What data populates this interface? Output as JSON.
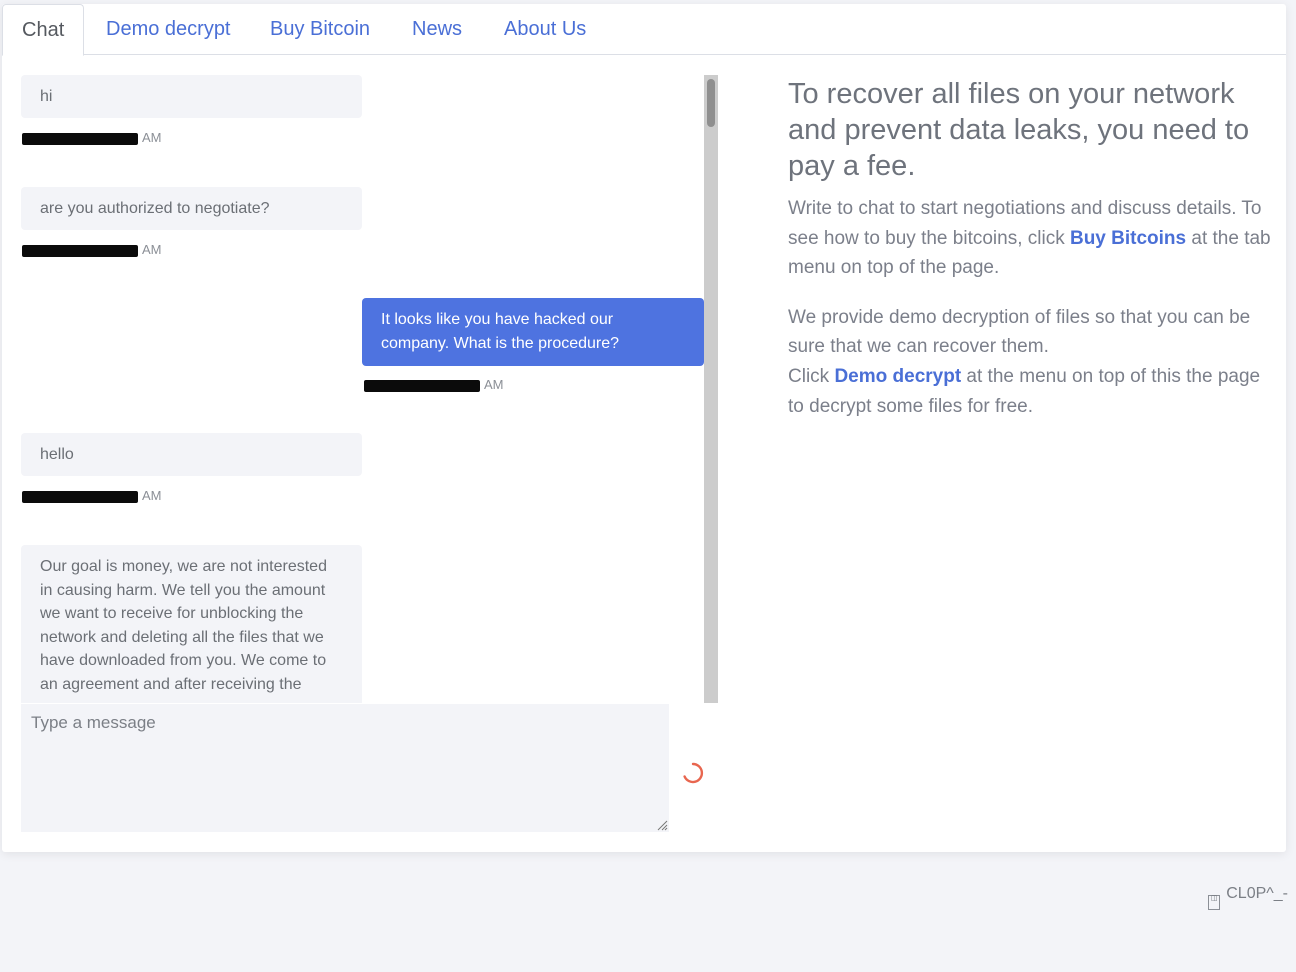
{
  "tabs": [
    {
      "label": "Chat"
    },
    {
      "label": "Demo decrypt"
    },
    {
      "label": "Buy Bitcoin"
    },
    {
      "label": "News"
    },
    {
      "label": "About Us"
    }
  ],
  "messages": [
    {
      "text": "hi",
      "time_suffix": "AM"
    },
    {
      "text": "are you authorized to negotiate?",
      "time_suffix": "AM"
    },
    {
      "text": "It looks like you have hacked our company. What is the procedure?",
      "time_suffix": "AM"
    },
    {
      "text": "hello",
      "time_suffix": "AM"
    },
    {
      "text": "Our goal is money, we are not interested in causing harm. We tell you the amount we want to receive for unblocking the network and deleting all the files that we have downloaded from you. We come to an agreement and after receiving the"
    }
  ],
  "composer": {
    "placeholder": "Type a message"
  },
  "info": {
    "heading": "To recover all files on your network and prevent data leaks, you need to pay a fee.",
    "p1_a": "Write to chat to start negotiations and discuss details. To see how to buy the bitcoins, click ",
    "p1_link": "Buy Bitcoins",
    "p1_b": " at the tab menu on top of the page.",
    "p2_a": "We provide demo decryption of files so that you can be sure that we can recover them.",
    "p2_b": "Click ",
    "p2_link": "Demo decrypt",
    "p2_c": " at the menu on top of this the page to decrypt some files for free."
  },
  "footer": {
    "text": "CL0P^_-"
  },
  "colors": {
    "accent": "#4a6fd6",
    "outgoing_bubble": "#4e73e0",
    "incoming_bubble": "#f3f4f8",
    "spinner": "#e8664f"
  }
}
